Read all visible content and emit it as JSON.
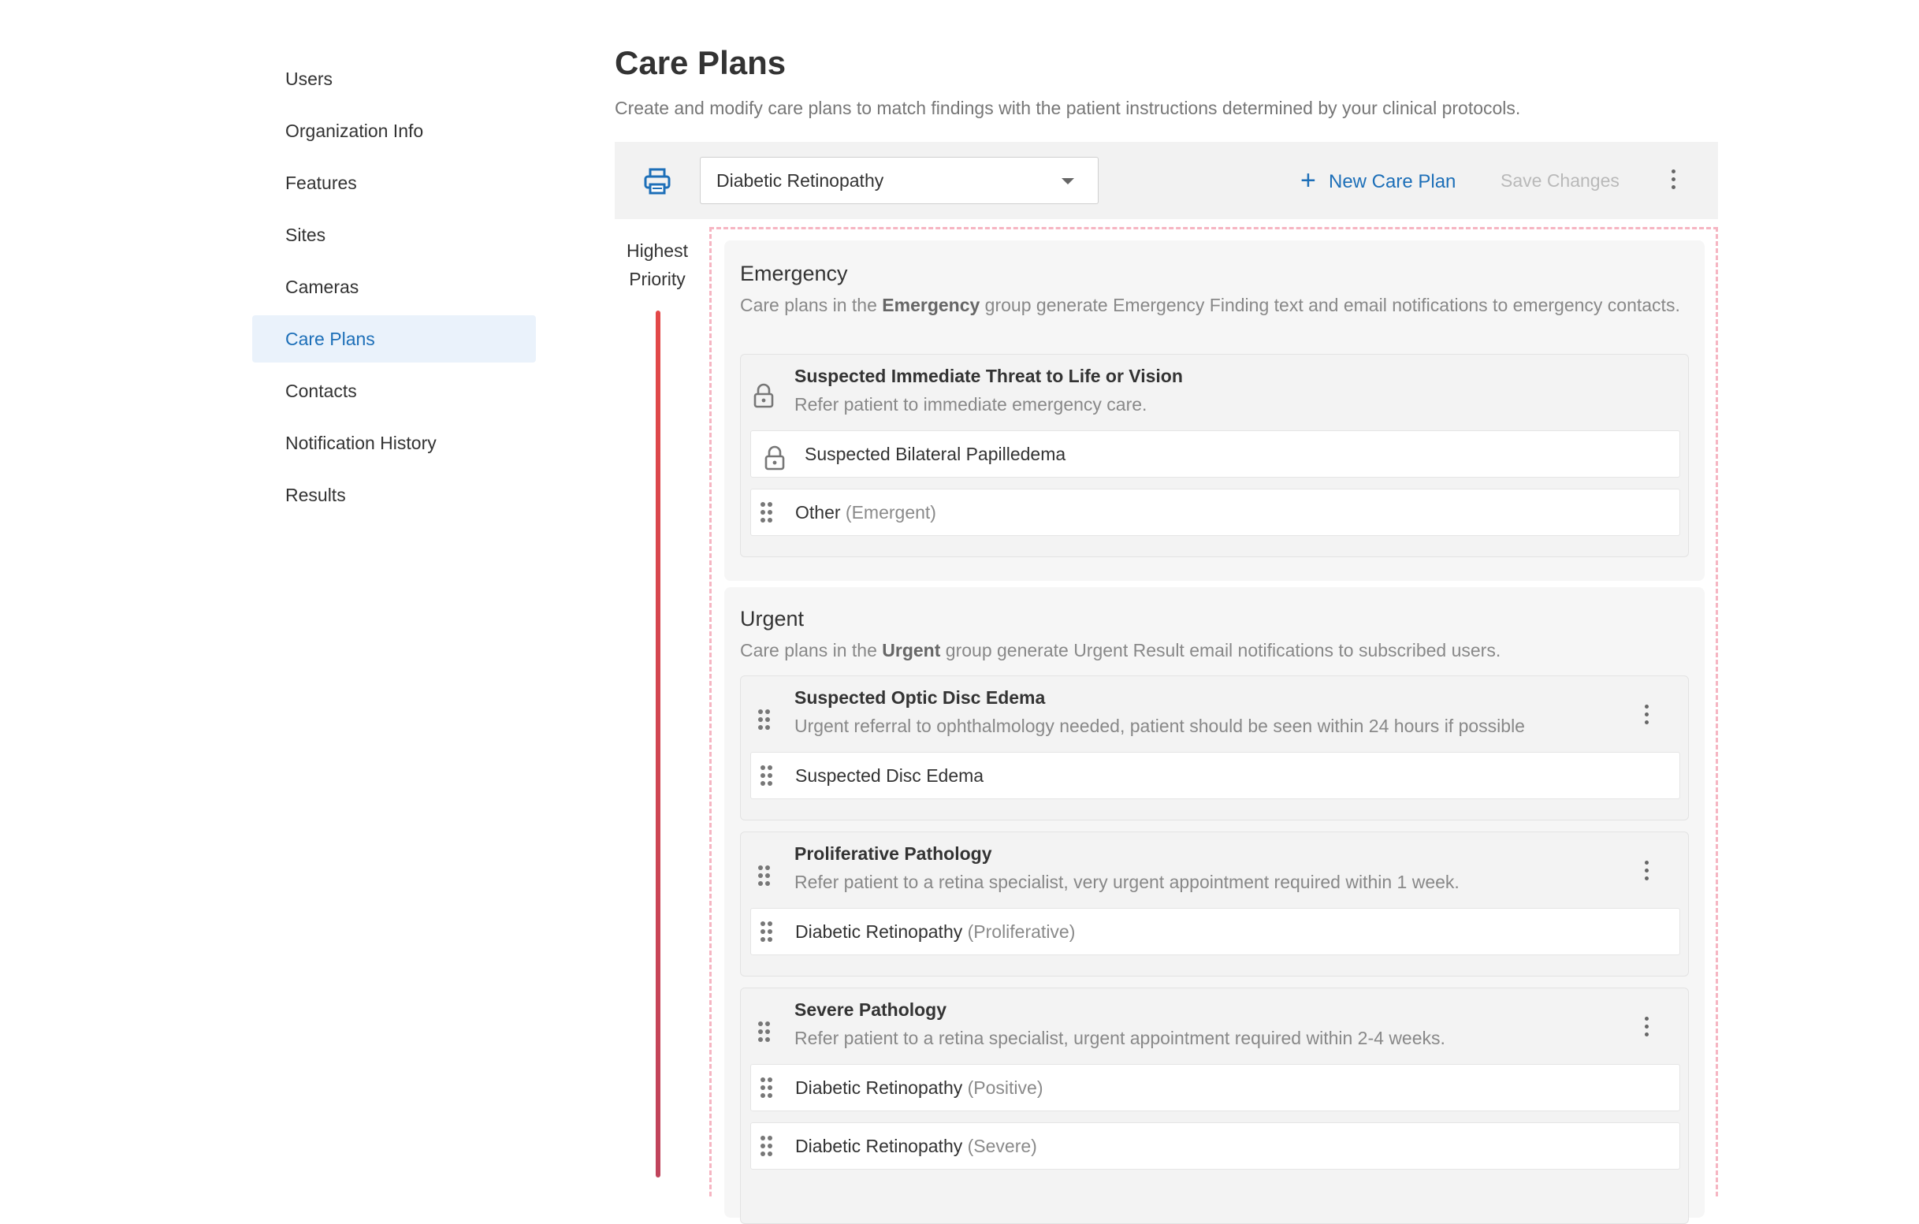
{
  "sidebar": {
    "items": [
      {
        "label": "Users"
      },
      {
        "label": "Organization Info"
      },
      {
        "label": "Features"
      },
      {
        "label": "Sites"
      },
      {
        "label": "Cameras"
      },
      {
        "label": "Care Plans",
        "active": true
      },
      {
        "label": "Contacts"
      },
      {
        "label": "Notification History"
      },
      {
        "label": "Results"
      }
    ]
  },
  "header": {
    "title": "Care Plans",
    "subtitle": "Create and modify care plans to match findings with the patient instructions determined by your clinical protocols."
  },
  "toolbar": {
    "print_icon": "printer-icon",
    "selected_condition": "Diabetic Retinopathy",
    "new_care_plan_label": "New Care Plan",
    "save_changes_label": "Save Changes",
    "accent_color": "#1d6fb8",
    "disabled_color": "#b9b9b9"
  },
  "priority": {
    "line1": "Highest",
    "line2": "Priority",
    "bar_color": "#e34848"
  },
  "groups": {
    "emergency": {
      "title": "Emergency",
      "desc_prefix": "Care plans in the ",
      "desc_bold": "Emergency",
      "desc_suffix": " group generate Emergency Finding text and email notifications to emergency contacts.",
      "plan": {
        "title": "Suspected Immediate Threat to Life or Vision",
        "desc": "Refer patient to immediate emergency care.",
        "findings": [
          {
            "text": "Suspected Bilateral Papilledema",
            "qualifier": ""
          },
          {
            "text": "Other",
            "qualifier": "(Emergent)"
          }
        ]
      }
    },
    "urgent": {
      "title": "Urgent",
      "desc_prefix": "Care plans in the ",
      "desc_bold": "Urgent",
      "desc_suffix": " group generate Urgent Result email notifications to subscribed users.",
      "plans": [
        {
          "title": "Suspected Optic Disc Edema",
          "desc": "Urgent referral to ophthalmology needed, patient should be seen within 24 hours if possible",
          "findings": [
            {
              "text": "Suspected Disc Edema",
              "qualifier": ""
            }
          ]
        },
        {
          "title": "Proliferative Pathology",
          "desc": "Refer patient to a retina specialist, very urgent appointment required within 1 week.",
          "findings": [
            {
              "text": "Diabetic Retinopathy",
              "qualifier": "(Proliferative)"
            }
          ]
        },
        {
          "title": "Severe Pathology",
          "desc": "Refer patient to a retina specialist, urgent appointment required within 2-4 weeks.",
          "findings": [
            {
              "text": "Diabetic Retinopathy",
              "qualifier": "(Positive)"
            },
            {
              "text": "Diabetic Retinopathy",
              "qualifier": "(Severe)"
            }
          ]
        }
      ]
    }
  }
}
